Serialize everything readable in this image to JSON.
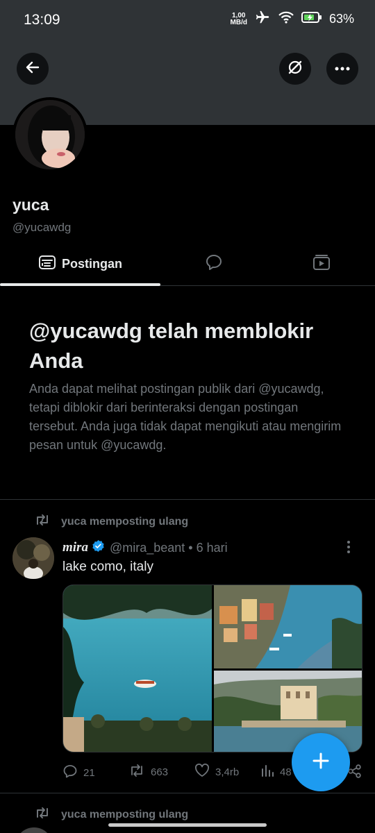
{
  "status_bar": {
    "time": "13:09",
    "net_speed_value": "1,00",
    "net_speed_unit": "MB/d",
    "battery": "63%"
  },
  "profile": {
    "name": "yuca",
    "handle": "@yucawdg"
  },
  "tabs": [
    {
      "label": "Postingan",
      "icon": "posts-icon",
      "active": true
    },
    {
      "label": "",
      "icon": "replies-icon",
      "active": false
    },
    {
      "label": "",
      "icon": "media-icon",
      "active": false
    }
  ],
  "blocked_notice": {
    "title": "@yucawdg telah memblokir Anda",
    "body": "Anda dapat melihat postingan publik dari @yucawdg, tetapi diblokir dari berinteraksi dengan postingan tersebut. Anda juga tidak dapat mengikuti atau mengirim pesan untuk @yucawdg."
  },
  "feed": [
    {
      "repost_label": "yuca memposting ulang",
      "author_name": "mira",
      "author_handle": "@mira_beant",
      "dot": "•",
      "time": "6 hari",
      "text": "lake como, italy",
      "stats": {
        "replies": "21",
        "reposts": "663",
        "likes": "3,4rb",
        "views": "48"
      }
    },
    {
      "repost_label": "yuca memposting ulang"
    }
  ],
  "colors": {
    "accent": "#1d9bf0",
    "muted": "#71767b",
    "text": "#e7e9ea",
    "banner": "#2f3336"
  }
}
